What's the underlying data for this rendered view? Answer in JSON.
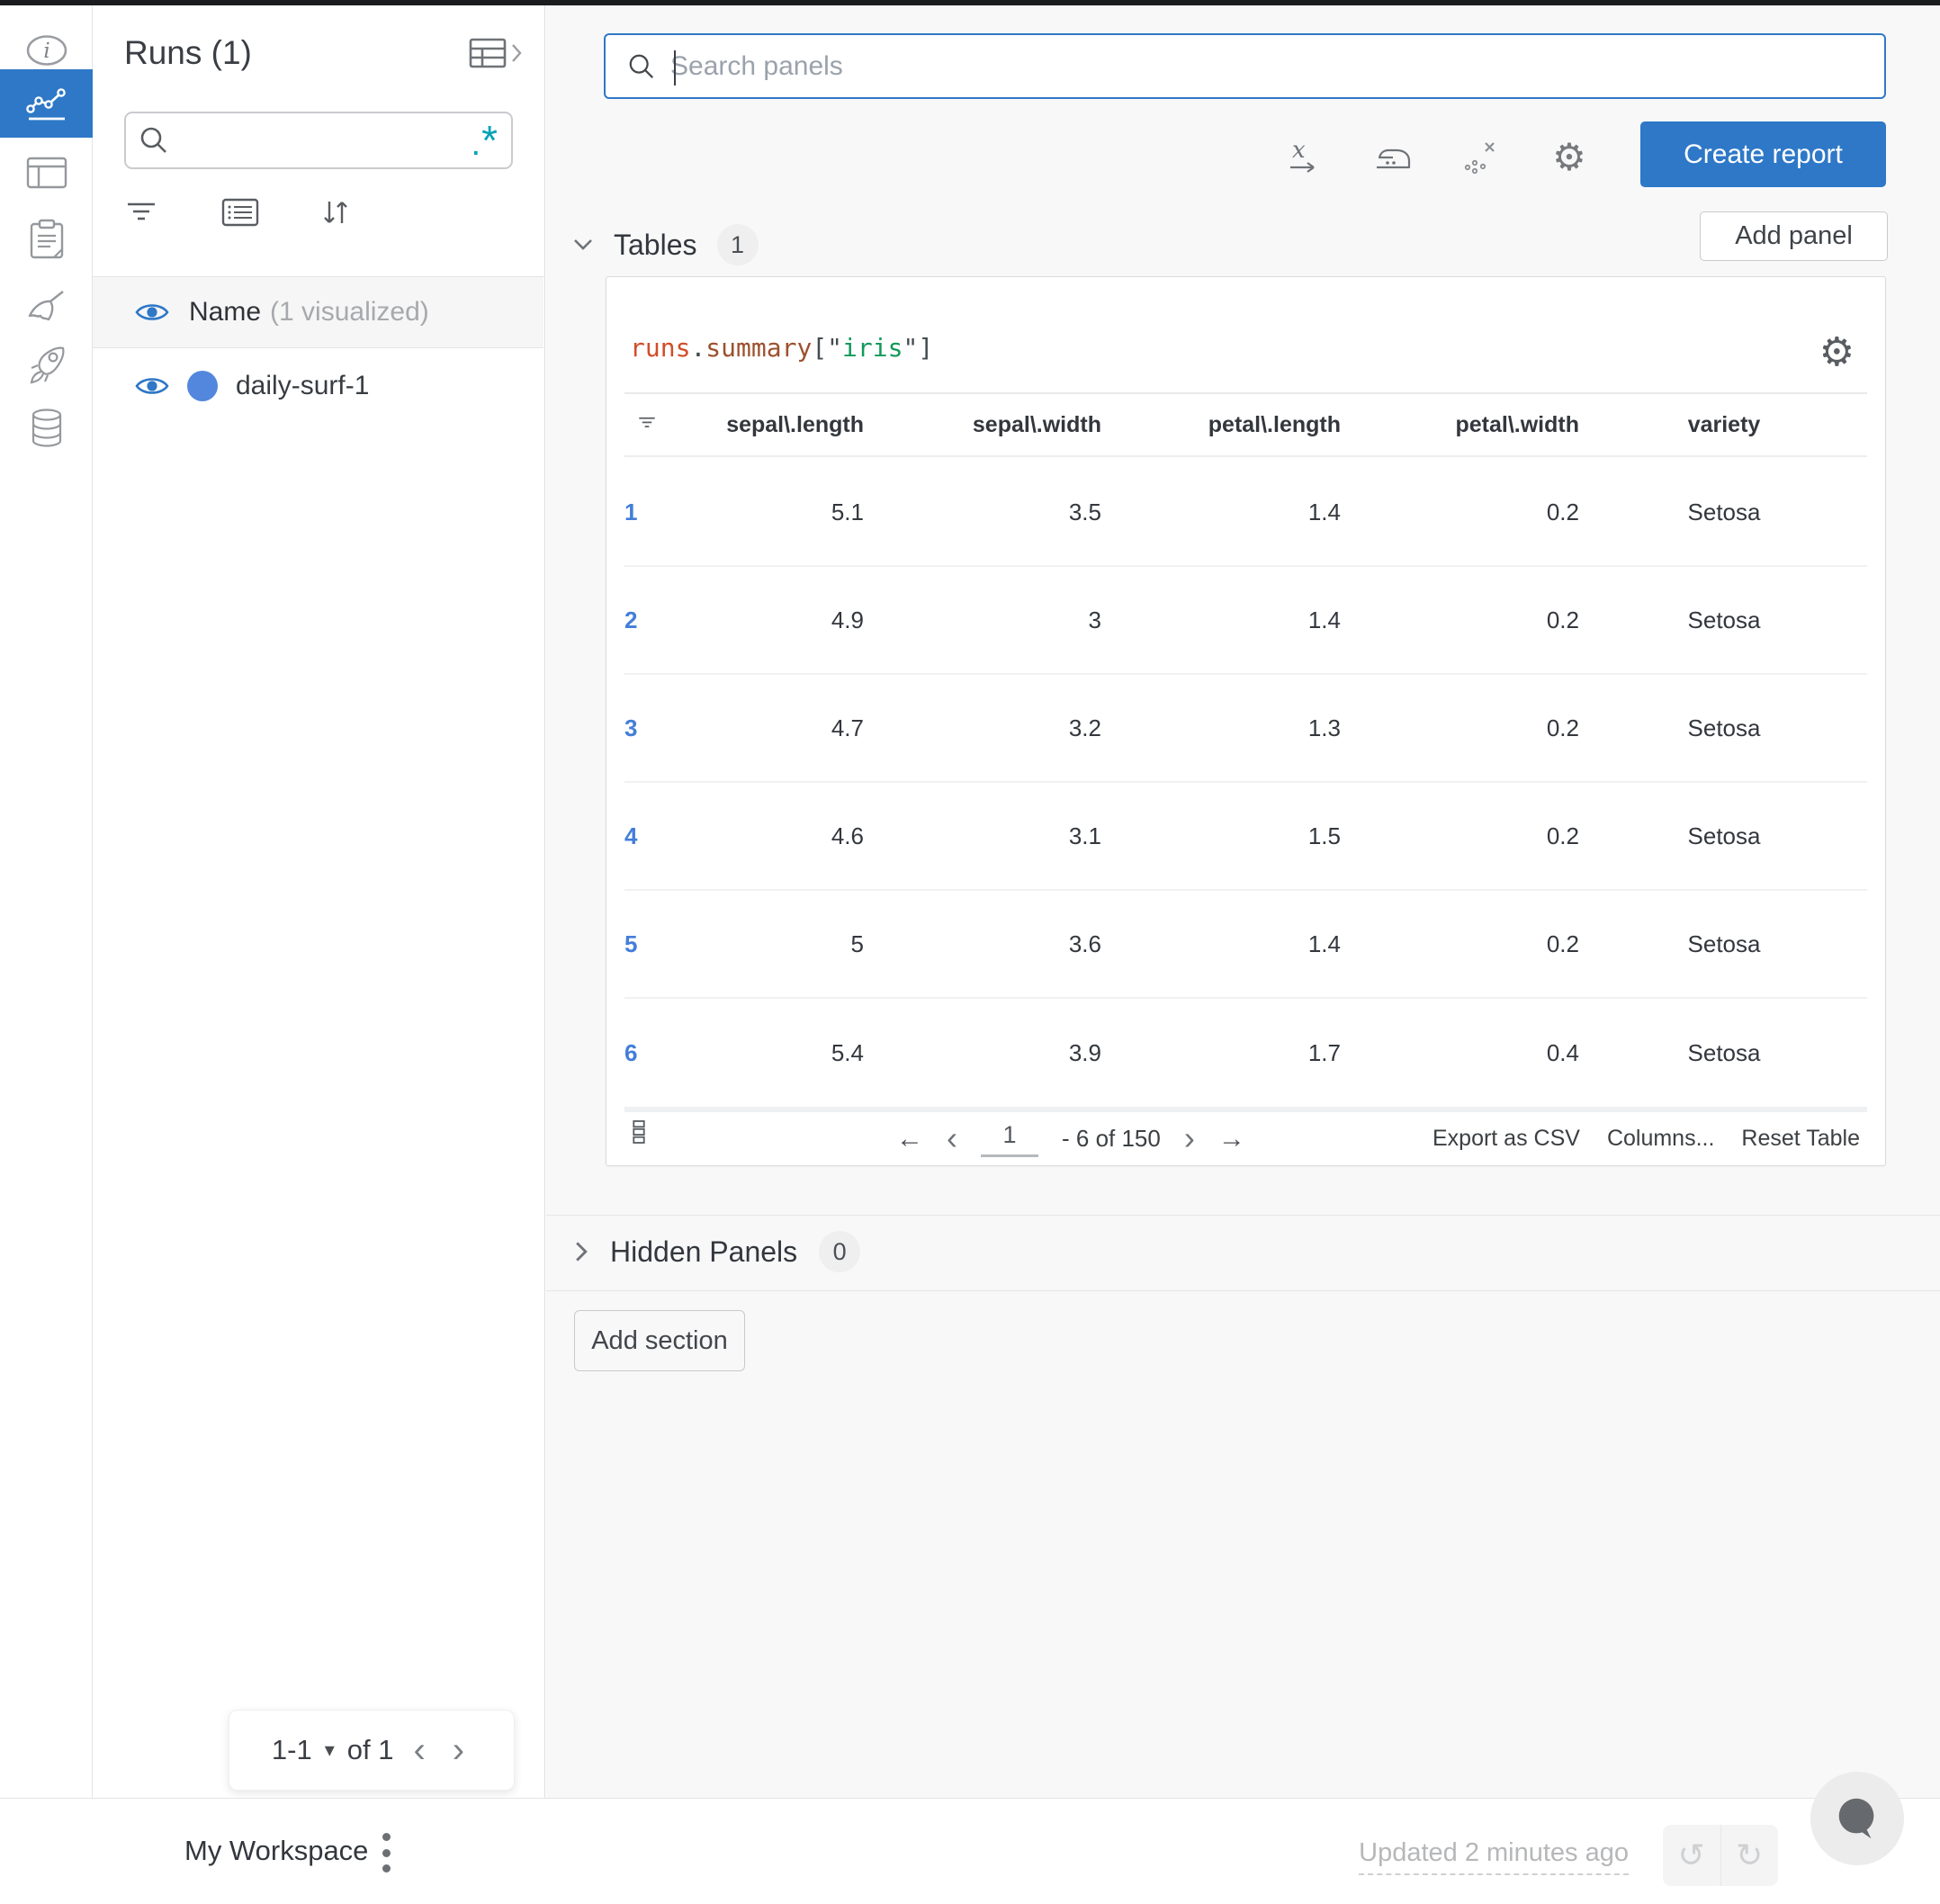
{
  "colors": {
    "accent_blue": "#2e78c7",
    "run_dot_blue": "#5387dd",
    "row_link_blue": "#437ed9",
    "regex_teal": "#00a3b7",
    "code_runs": "#d14d28",
    "code_summary": "#9c512e",
    "code_key_green": "#13995a"
  },
  "rail": {
    "items": [
      "info",
      "line-chart (active)",
      "panels",
      "notes",
      "sweep",
      "rocket",
      "artifacts"
    ]
  },
  "runs_panel": {
    "title": "Runs (1)",
    "regex_dot": ".",
    "regex_star": "*",
    "name_label": "Name",
    "name_suffix": "(1 visualized)",
    "run_name": "daily-surf-1",
    "pager": {
      "range": "1-1",
      "of": "of 1"
    }
  },
  "toolbar": {
    "search_placeholder": "Search panels",
    "create_report": "Create report"
  },
  "tables_section": {
    "label": "Tables",
    "count": "1",
    "add_panel": "Add panel"
  },
  "hidden_section": {
    "label": "Hidden Panels",
    "count": "0"
  },
  "add_section_label": "Add section",
  "panel": {
    "title": {
      "runs": "runs",
      "dot": ".",
      "summary": "summary",
      "open": "[\"",
      "key": "iris",
      "close": "\"]"
    },
    "columns": [
      "sepal\\.length",
      "sepal\\.width",
      "petal\\.length",
      "petal\\.width",
      "variety"
    ],
    "rows": [
      {
        "n": "1",
        "c": [
          "5.1",
          "3.5",
          "1.4",
          "0.2",
          "Setosa"
        ]
      },
      {
        "n": "2",
        "c": [
          "4.9",
          "3",
          "1.4",
          "0.2",
          "Setosa"
        ]
      },
      {
        "n": "3",
        "c": [
          "4.7",
          "3.2",
          "1.3",
          "0.2",
          "Setosa"
        ]
      },
      {
        "n": "4",
        "c": [
          "4.6",
          "3.1",
          "1.5",
          "0.2",
          "Setosa"
        ]
      },
      {
        "n": "5",
        "c": [
          "5",
          "3.6",
          "1.4",
          "0.2",
          "Setosa"
        ]
      },
      {
        "n": "6",
        "c": [
          "5.4",
          "3.9",
          "1.7",
          "0.4",
          "Setosa"
        ]
      }
    ],
    "footer": {
      "page": "1",
      "range": "- 6 of 150",
      "export": "Export as CSV",
      "columns": "Columns...",
      "reset": "Reset Table"
    }
  },
  "bottom": {
    "workspace": "My Workspace",
    "updated": "Updated 2 minutes ago"
  },
  "glyphs": {
    "gear": "⚙",
    "caret_down": "▾",
    "chev_left": "‹",
    "chev_right": "›",
    "arrow_left": "←",
    "arrow_right": "→",
    "undo": "↺",
    "redo": "↻"
  }
}
